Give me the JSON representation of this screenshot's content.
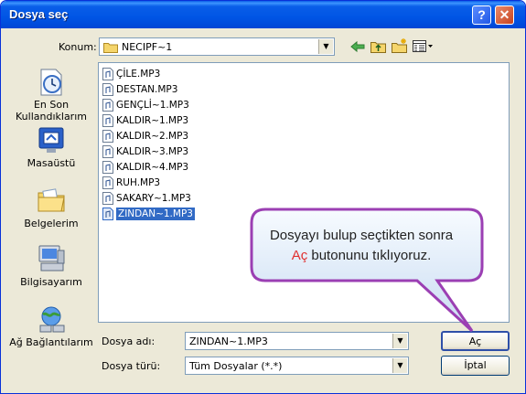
{
  "window": {
    "title": "Dosya seç",
    "help_glyph": "?",
    "close_glyph": "✕"
  },
  "location": {
    "label": "Konum:",
    "value": "NECIPF~1"
  },
  "places": [
    {
      "label": "En Son\nKullandıklarım"
    },
    {
      "label": "Masaüstü"
    },
    {
      "label": "Belgelerim"
    },
    {
      "label": "Bilgisayarım"
    },
    {
      "label": "Ağ Bağlantılarım"
    }
  ],
  "files": [
    {
      "name": "ÇİLE.MP3"
    },
    {
      "name": "DESTAN.MP3"
    },
    {
      "name": "GENÇLİ~1.MP3"
    },
    {
      "name": "KALDIR~1.MP3"
    },
    {
      "name": "KALDIR~2.MP3"
    },
    {
      "name": "KALDIR~3.MP3"
    },
    {
      "name": "KALDIR~4.MP3"
    },
    {
      "name": "RUH.MP3"
    },
    {
      "name": "SAKARY~1.MP3"
    },
    {
      "name": "ZINDAN~1.MP3",
      "selected": true
    }
  ],
  "filename": {
    "label": "Dosya adı:",
    "value": "ZINDAN~1.MP3"
  },
  "filetype": {
    "label": "Dosya türü:",
    "value": "Tüm Dosyalar (*.*)"
  },
  "buttons": {
    "open": "Aç",
    "cancel": "İptal"
  },
  "callout": {
    "line1": "Dosyayı bulup seçtikten sonra",
    "highlight": "Aç",
    "line2_rest": " butonunu tıklıyoruz."
  },
  "colors": {
    "title_bar": "#0055e5",
    "selection": "#316ac5",
    "callout_border": "#9b3fb3",
    "highlight": "#e03030"
  }
}
